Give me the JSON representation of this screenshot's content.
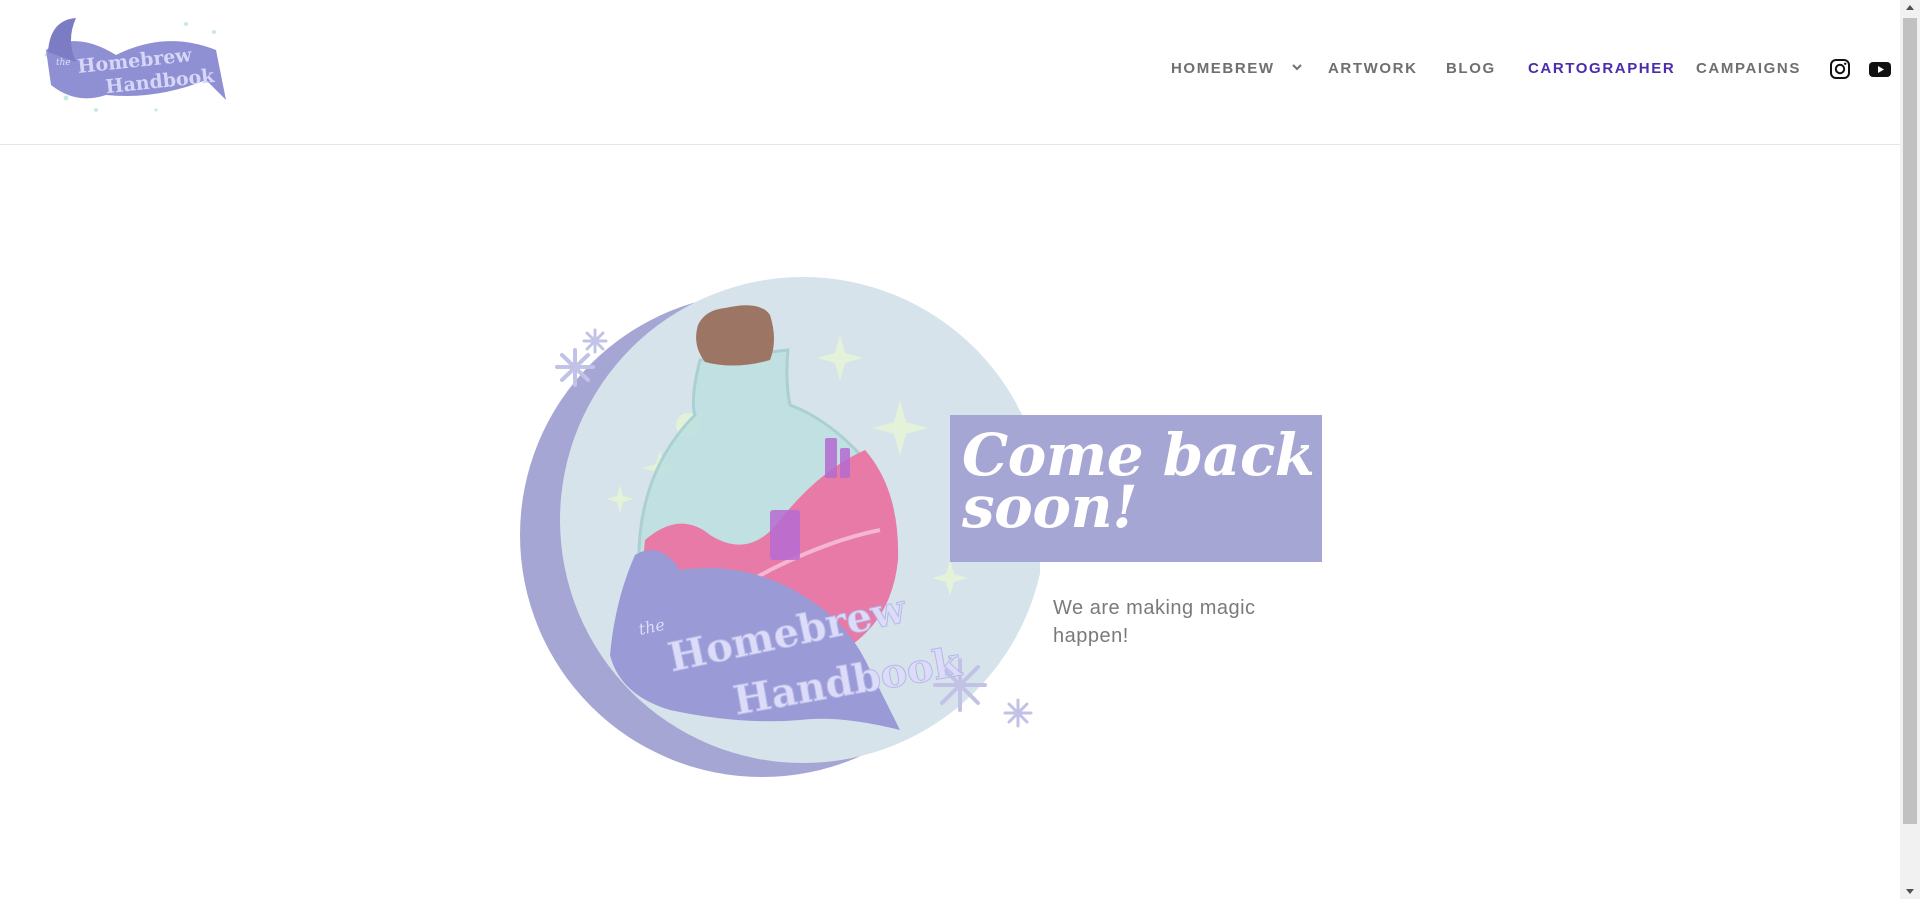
{
  "header": {
    "logo": {
      "prefix": "the",
      "line1": "Homebrew",
      "line2": "Handbook"
    },
    "nav": [
      {
        "label": "HOMEBREW",
        "has_dropdown": true,
        "active": false
      },
      {
        "label": "ARTWORK",
        "has_dropdown": false,
        "active": false
      },
      {
        "label": "BLOG",
        "has_dropdown": false,
        "active": false
      },
      {
        "label": "CARTOGRAPHER",
        "has_dropdown": false,
        "active": true
      },
      {
        "label": "CAMPAIGNS",
        "has_dropdown": false,
        "active": false
      }
    ],
    "social": [
      {
        "icon": "instagram-icon"
      },
      {
        "icon": "youtube-icon"
      }
    ]
  },
  "hero": {
    "banner": {
      "prefix": "the",
      "line1": "Homebrew",
      "line2": "Handbook"
    },
    "headline_line1": "Come back",
    "headline_line2": "soon!",
    "subtext": "We are making magic happen!"
  },
  "colors": {
    "accent": "#4b2cae",
    "lavender": "#a6a6d4",
    "nav_text": "#6f6f6f"
  }
}
